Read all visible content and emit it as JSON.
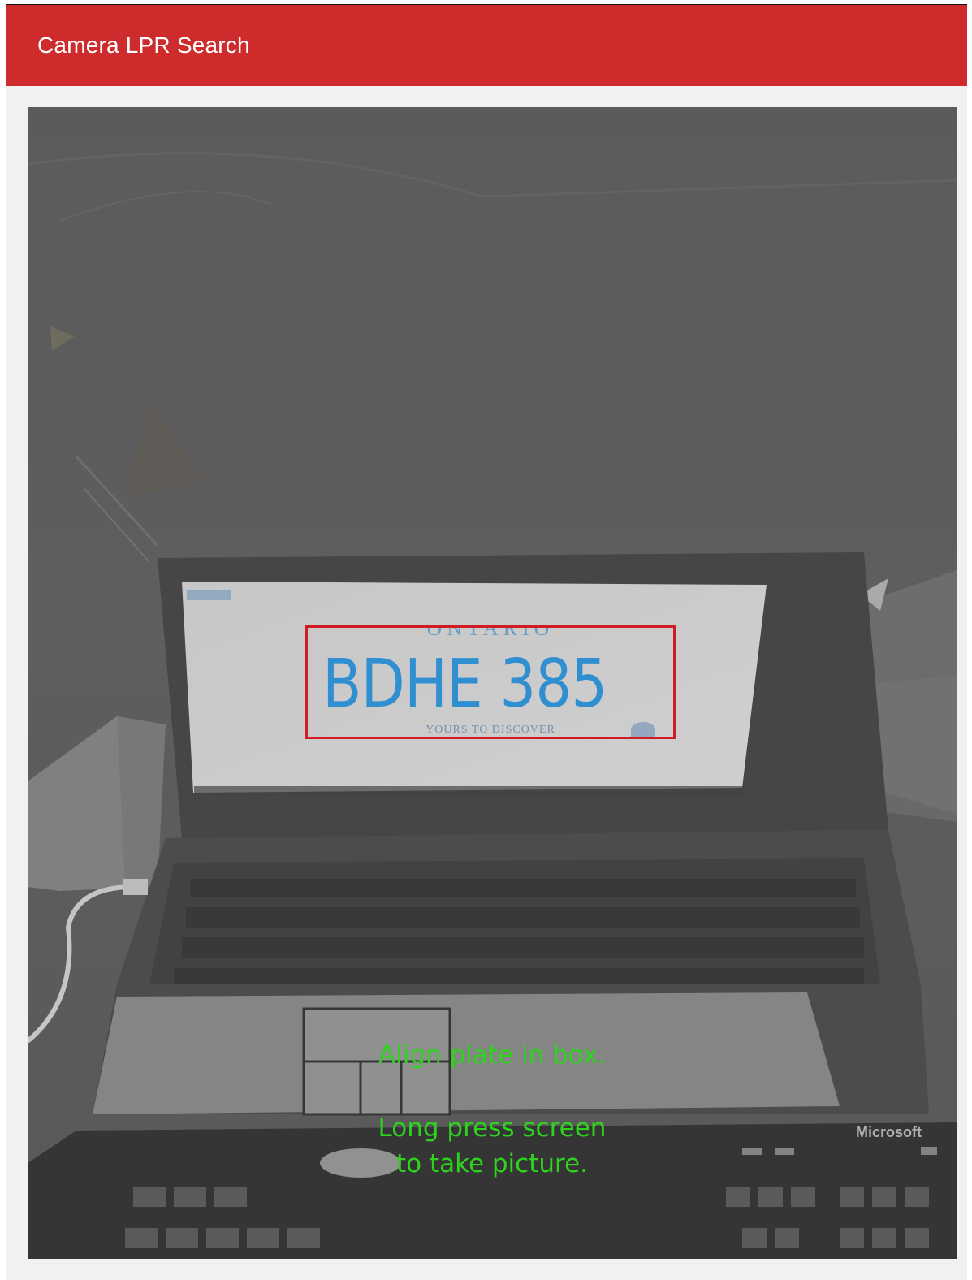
{
  "app_bar": {
    "title": "Camera LPR Search",
    "color": "#cd2b2c"
  },
  "camera_preview": {
    "overlay_box_color": "#d21c24",
    "plate": {
      "province": "ONTARIO",
      "number": "BDHE 385",
      "slogan": "YOURS TO DISCOVER"
    },
    "background_brand": "Microsoft"
  },
  "instructions": {
    "align": "Align plate in box.",
    "press_line1": "Long press screen",
    "press_line2": "to take picture.",
    "color": "#2ed31d"
  }
}
